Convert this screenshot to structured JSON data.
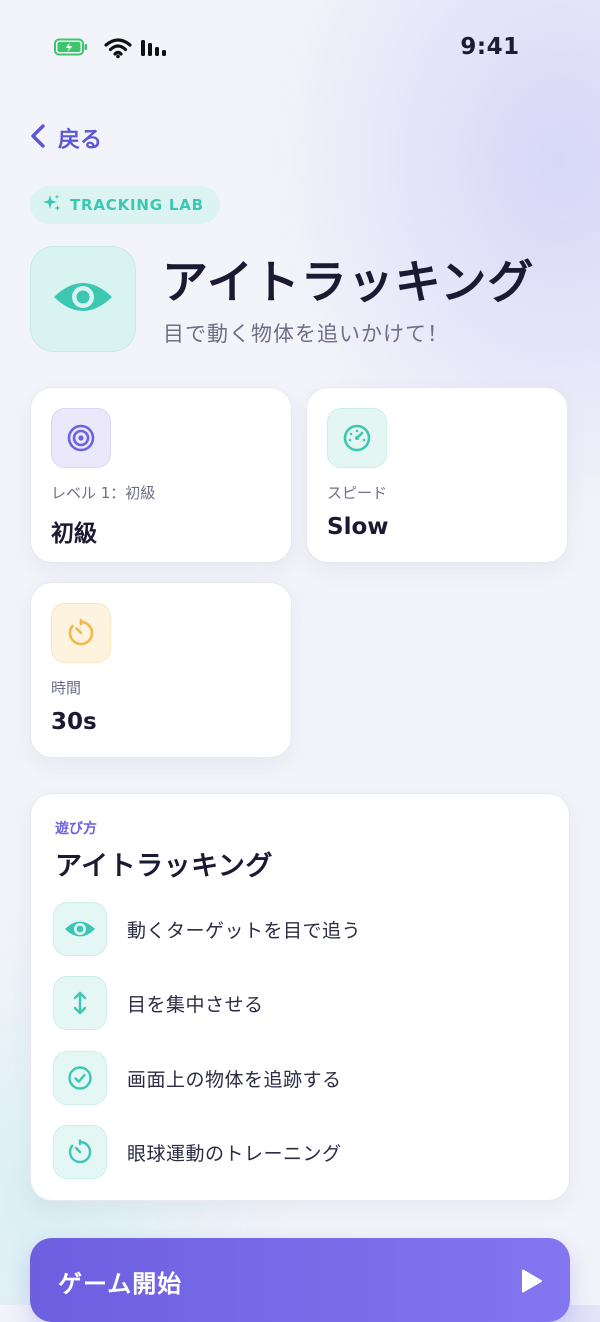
{
  "status_bar": {
    "time": "9:41"
  },
  "nav": {
    "back_label": "戻る"
  },
  "badge": {
    "label": "TRACKING LAB"
  },
  "hero": {
    "title": "アイトラッキング",
    "subtitle": "目で動く物体を追いかけて！",
    "icon": "eye-icon"
  },
  "stats": [
    {
      "label": "レベル 1：初級",
      "value": "初級",
      "icon": "target-icon",
      "color": "#6d63e0"
    },
    {
      "label": "スピード",
      "value": "Slow",
      "icon": "speedometer-icon",
      "color": "#3cc7b3"
    },
    {
      "label": "時間",
      "value": "30s",
      "icon": "timer-icon",
      "color": "#f0b94c"
    }
  ],
  "how_to_play": {
    "eyebrow": "遊び方",
    "title": "アイトラッキング",
    "steps": [
      {
        "text": "動くターゲットを目で追う",
        "icon": "eye-icon"
      },
      {
        "text": "目を集中させる",
        "icon": "vertical-arrows-icon"
      },
      {
        "text": "画面上の物体を追跡する",
        "icon": "check-circle-icon"
      },
      {
        "text": "眼球運動のトレーニング",
        "icon": "timer-icon"
      }
    ]
  },
  "start_button": {
    "label": "ゲーム開始",
    "icon": "play-icon"
  },
  "colors": {
    "accent": "#6d63e0",
    "teal": "#3cc7b3",
    "amber": "#f0b94c",
    "text": "#1a1b33"
  }
}
